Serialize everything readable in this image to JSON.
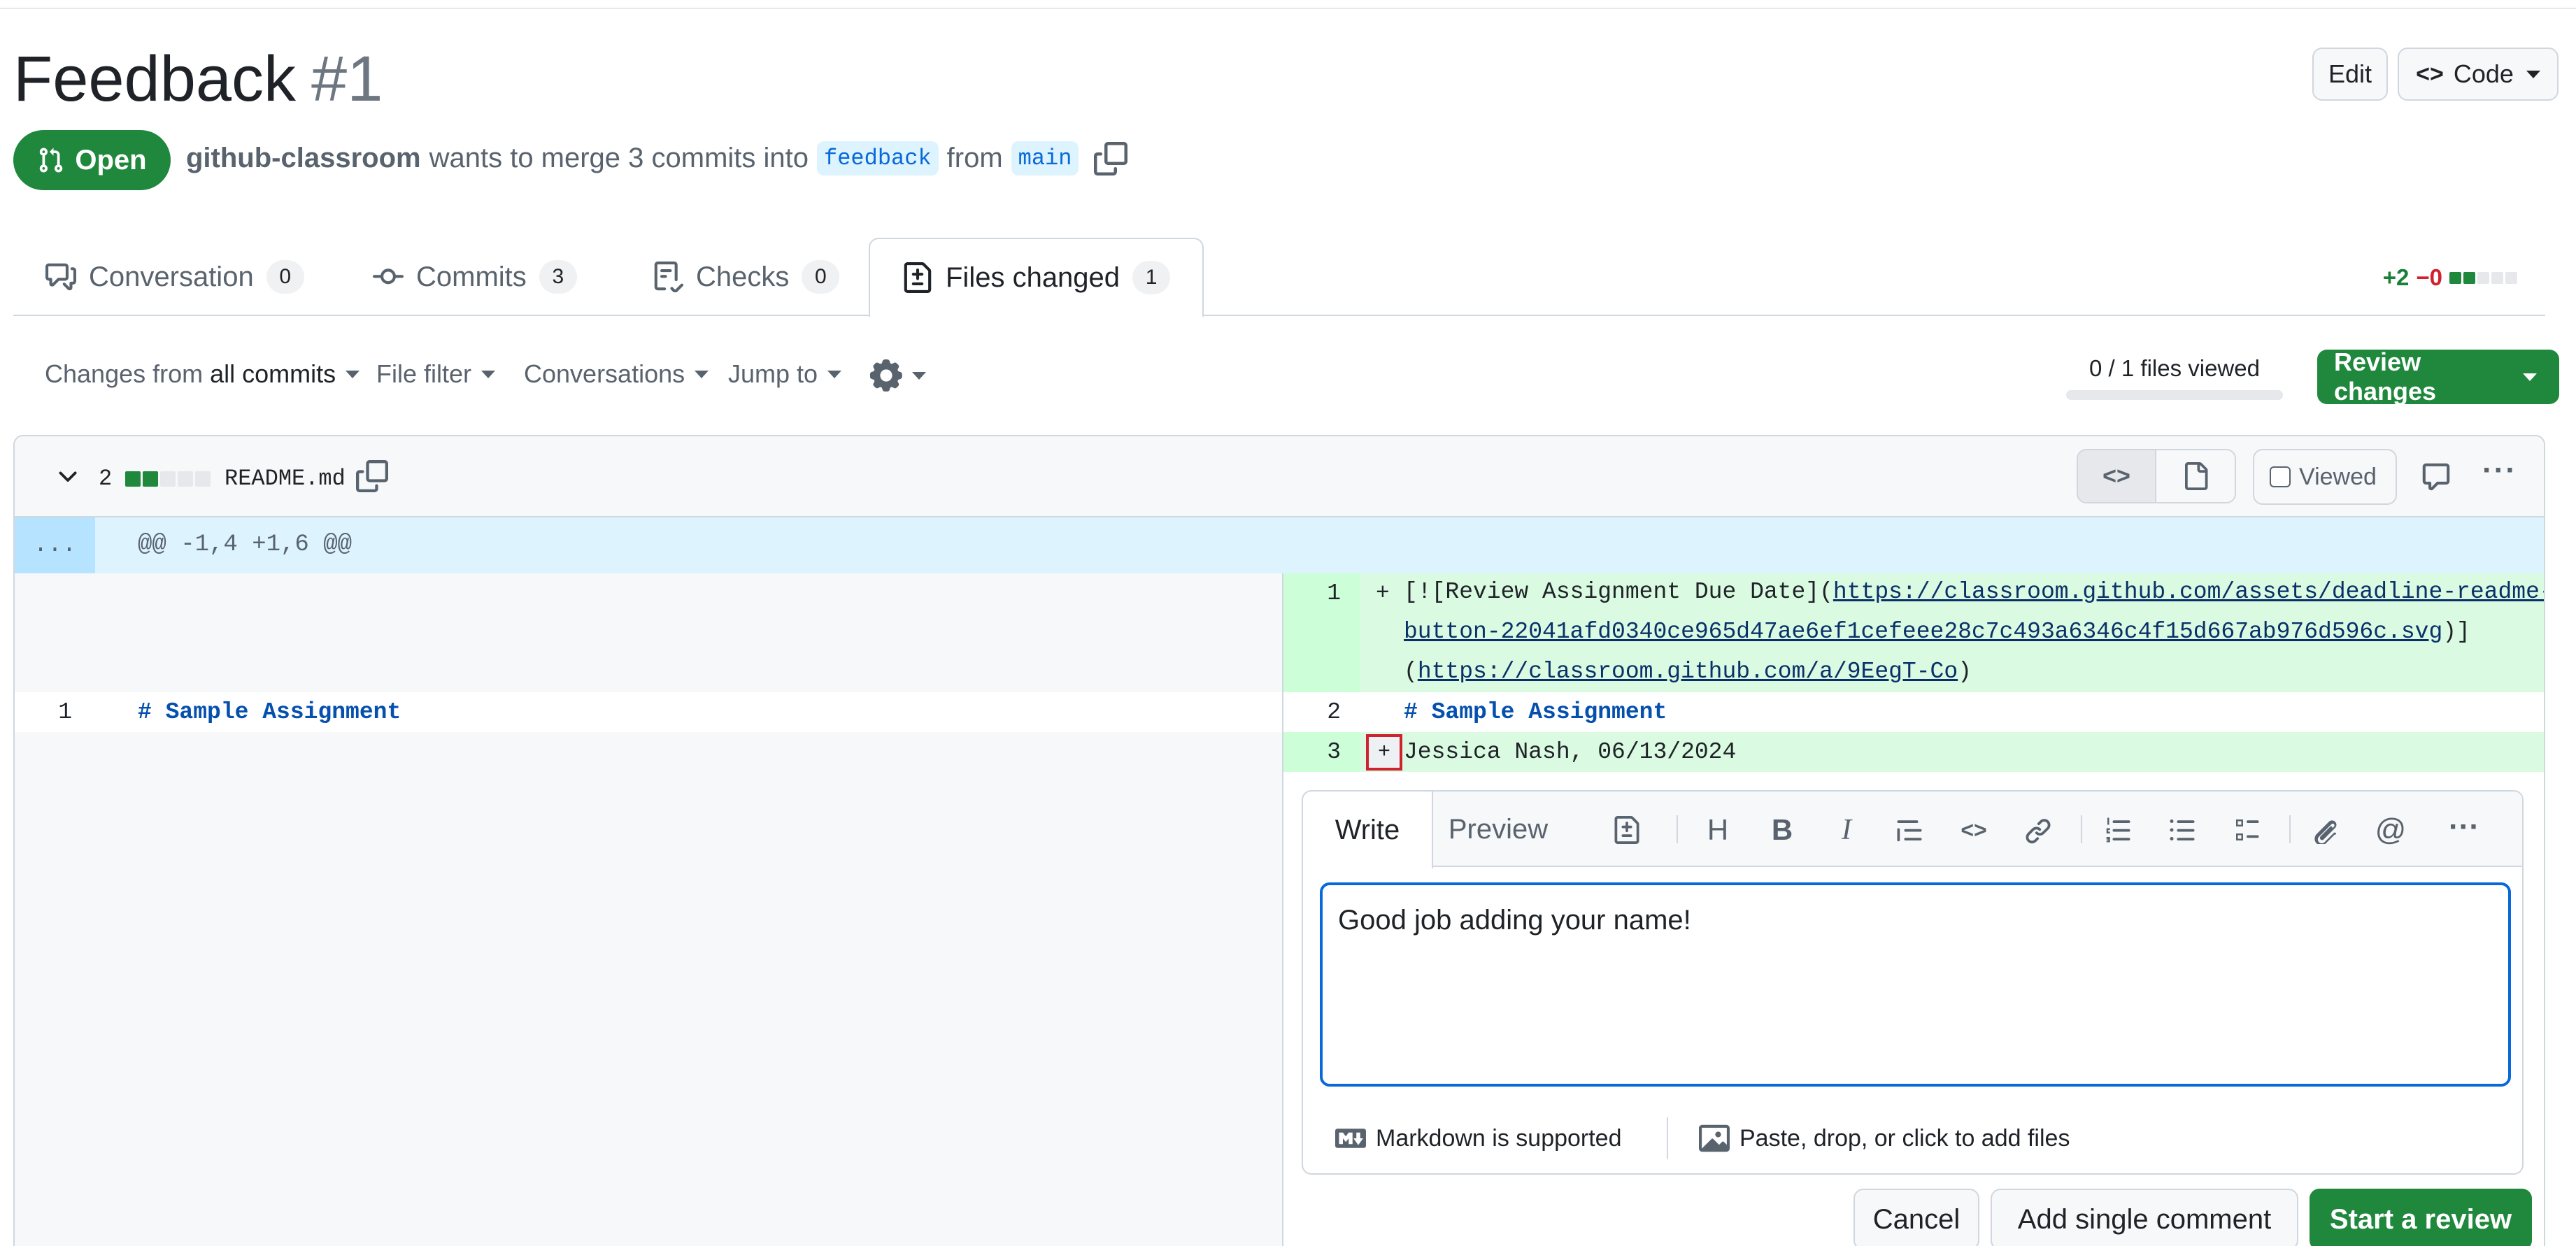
{
  "pr": {
    "title": "Feedback",
    "number": "#1",
    "state": "Open",
    "author": "github-classroom",
    "merge_text": "wants to merge 3 commits into",
    "base_branch": "feedback",
    "from_text": "from",
    "head_branch": "main",
    "edit_label": "Edit",
    "code_label": "Code"
  },
  "tabs": [
    {
      "label": "Conversation",
      "count": "0"
    },
    {
      "label": "Commits",
      "count": "3"
    },
    {
      "label": "Checks",
      "count": "0"
    },
    {
      "label": "Files changed",
      "count": "1"
    }
  ],
  "diffstat": {
    "additions": "+2",
    "deletions": "−0"
  },
  "toolbar": {
    "changes_prefix": "Changes from",
    "changes_value": "all commits",
    "file_filter": "File filter",
    "conversations": "Conversations",
    "jump_to": "Jump to",
    "files_viewed": "0 / 1 files viewed",
    "review_changes": "Review changes"
  },
  "file": {
    "changes_count": "2",
    "name": "README.md",
    "viewed_label": "Viewed",
    "hunk_expand": "...",
    "hunk_header": "@@ -1,4 +1,6 @@"
  },
  "left_lines": [
    {
      "num": "1",
      "text": "# Sample Assignment"
    }
  ],
  "right_lines": [
    {
      "num": "1",
      "marker": "+",
      "pre": "[![Review Assignment Due Date](",
      "link1": "https://classroom.github.com/assets/deadline-readme-",
      "link1b": "button-22041afd0340ce965d47ae6ef1cefeee28c7c493a6346c4f15d667ab976d596c.svg",
      "mid": ")]",
      "open": "(",
      "link2": "https://classroom.github.com/a/9EegT-Co",
      "close": ")"
    },
    {
      "num": "2",
      "marker": "",
      "text": "# Sample Assignment"
    },
    {
      "num": "3",
      "marker": "+",
      "text": "Jessica Nash, 06/13/2024"
    }
  ],
  "comment": {
    "write_tab": "Write",
    "preview_tab": "Preview",
    "body": "Good job adding your name!",
    "markdown_note": "Markdown is supported",
    "attach_note": "Paste, drop, or click to add files"
  },
  "actions": {
    "cancel": "Cancel",
    "add_single": "Add single comment",
    "start_review": "Start a review"
  },
  "colors": {
    "accent_green": "#1f883d",
    "link_blue": "#0969da",
    "added_bg": "#dafbe1",
    "added_num_bg": "#ccffd8",
    "hunk_bg": "#ddf4ff"
  }
}
